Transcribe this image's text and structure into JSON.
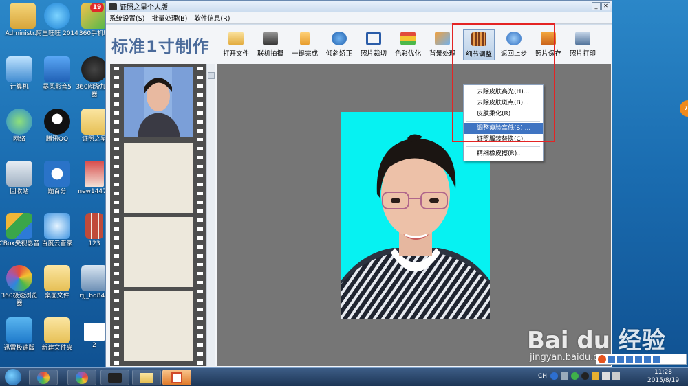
{
  "desktop": {
    "icons": [
      {
        "label": "Administr..."
      },
      {
        "label": "阿里旺旺 2014"
      },
      {
        "label": "360手机助"
      },
      {
        "label": "计算机"
      },
      {
        "label": "暴风影音5"
      },
      {
        "label": "360网游加速器"
      },
      {
        "label": "网络"
      },
      {
        "label": "腾讯QQ"
      },
      {
        "label": "证照之星"
      },
      {
        "label": "回收站"
      },
      {
        "label": "题百分"
      },
      {
        "label": "new14471"
      },
      {
        "label": "CBox央视影音"
      },
      {
        "label": "百度云管家"
      },
      {
        "label": "123"
      },
      {
        "label": "360极速浏览器"
      },
      {
        "label": "桌面文件"
      },
      {
        "label": "rjj_bd846"
      },
      {
        "label": "迅雷极速版"
      },
      {
        "label": "新建文件夹"
      },
      {
        "label": "2"
      }
    ],
    "badge_360": "19",
    "right_bubble": "70"
  },
  "window": {
    "title": "证照之星个人版",
    "menu": [
      "系统设置(S)",
      "批量处理(B)",
      "软件信息(R)"
    ],
    "logo": "标准1寸制作",
    "toolbar": [
      {
        "label": "打开文件",
        "icon": "folder-icon"
      },
      {
        "label": "联机拍摄",
        "icon": "camera-icon"
      },
      {
        "label": "一键完成",
        "icon": "hand-icon"
      },
      {
        "label": "倾斜矫正",
        "icon": "rotate-icon"
      },
      {
        "label": "照片裁切",
        "icon": "crop-icon"
      },
      {
        "label": "色彩优化",
        "icon": "color-icon"
      },
      {
        "label": "背景处理",
        "icon": "background-icon"
      },
      {
        "label": "细节调整",
        "icon": "detail-icon"
      },
      {
        "label": "返回上步",
        "icon": "undo-icon"
      },
      {
        "label": "照片保存",
        "icon": "save-icon"
      },
      {
        "label": "照片打印",
        "icon": "print-icon"
      }
    ],
    "dropdown": [
      "去除皮肤高光(H)...",
      "去除皮肤斑点(B)...",
      "皮肤柔化(R)",
      "调整瘦脸高低(S) ...",
      "证照服装替换(C)...",
      "精细橡皮擦(R)..."
    ],
    "colors": {
      "photo_bg": "#06f2f2",
      "highlight": "#3f74c2",
      "annotation": "#e42424"
    }
  },
  "taskbar": {
    "ime": "CH",
    "time": "11:28",
    "date": "2015/8/19"
  },
  "watermark": {
    "brand": "Bai du 经验",
    "url": "jingyan.baidu.com"
  }
}
